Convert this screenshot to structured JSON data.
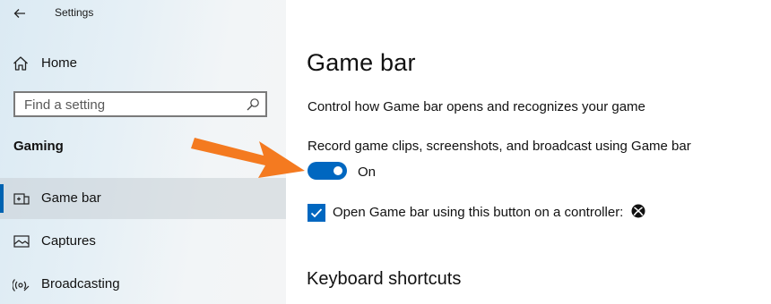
{
  "window": {
    "title": "Settings"
  },
  "sidebar": {
    "home_label": "Home",
    "search_placeholder": "Find a setting",
    "section_heading": "Gaming",
    "items": [
      {
        "label": "Game bar",
        "icon": "game-bar-icon",
        "active": true
      },
      {
        "label": "Captures",
        "icon": "captures-icon",
        "active": false
      },
      {
        "label": "Broadcasting",
        "icon": "broadcasting-icon",
        "active": false
      }
    ]
  },
  "main": {
    "title": "Game bar",
    "description": "Control how Game bar opens and recognizes your game",
    "record_toggle": {
      "label": "Record game clips, screenshots, and broadcast using Game bar",
      "state_text": "On",
      "on": true
    },
    "controller_checkbox": {
      "label": "Open Game bar using this button on a controller:",
      "checked": true,
      "icon": "xbox-logo-icon"
    },
    "keyboard_shortcuts_heading": "Keyboard shortcuts"
  },
  "colors": {
    "accent": "#0067c0",
    "annotation_arrow": "#f47a20"
  }
}
